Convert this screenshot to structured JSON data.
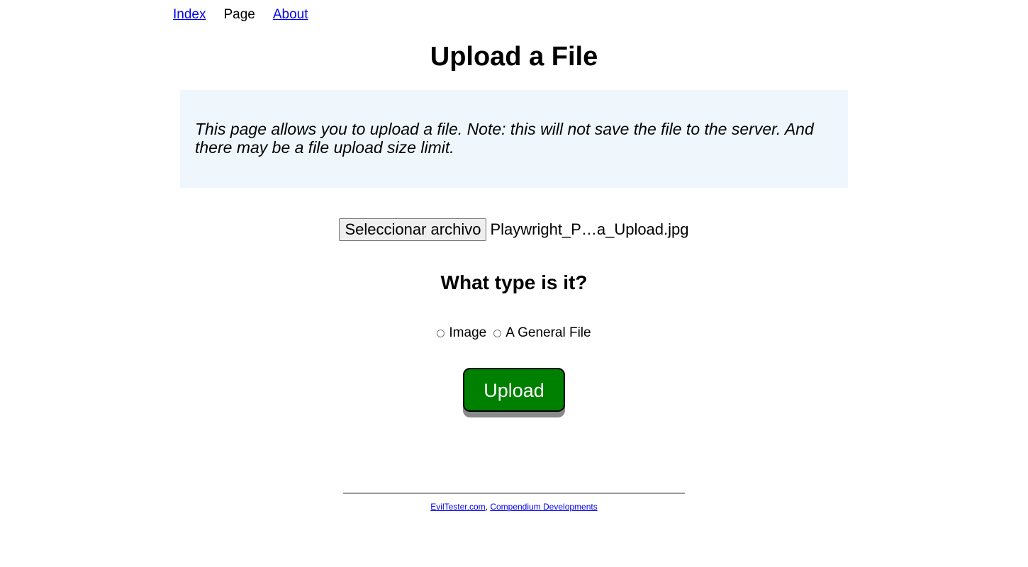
{
  "nav": {
    "items": [
      {
        "label": "Index",
        "link": true
      },
      {
        "label": "Page",
        "link": false
      },
      {
        "label": "About",
        "link": true
      }
    ]
  },
  "page_title": "Upload a File",
  "explanation": "This page allows you to upload a file. Note: this will not save the file to the server. And there may be a file upload size limit.",
  "file_input": {
    "button_label": "Seleccionar archivo",
    "file_name": "Playwright_P…a_Upload.jpg"
  },
  "type_heading": "What type is it?",
  "type_options": [
    {
      "label": "Image",
      "checked": false
    },
    {
      "label": "A General File",
      "checked": false
    }
  ],
  "upload_button_label": "Upload",
  "colors": {
    "link": "#0000ee",
    "explanation_bg": "#eff7fd",
    "upload_bg": "#008000",
    "upload_shadow": "#8a8a8a"
  },
  "footer": {
    "link1": "EvilTester.com",
    "separator": ", ",
    "link2": "Compendium Developments"
  }
}
